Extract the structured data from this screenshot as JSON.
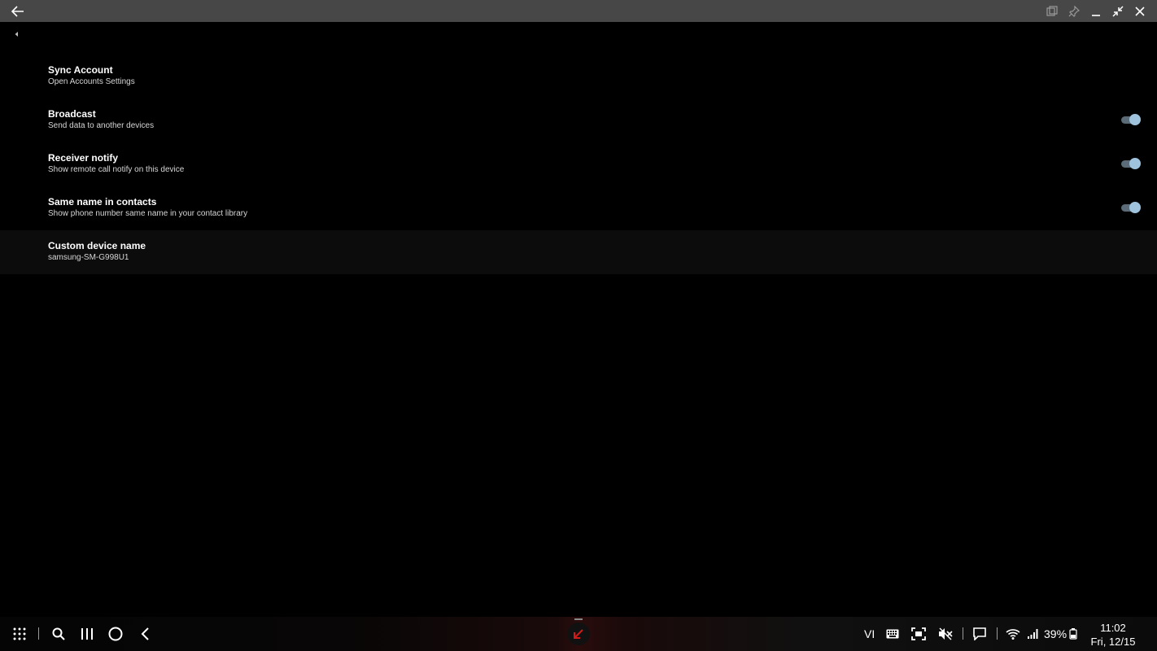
{
  "window": {
    "back_icon": "back-arrow-icon",
    "controls": [
      "popup-view-icon",
      "pin-icon",
      "minimize-icon",
      "restore-icon",
      "close-icon"
    ]
  },
  "settings": [
    {
      "title": "Sync Account",
      "subtitle": "Open Accounts Settings",
      "toggle": null
    },
    {
      "title": "Broadcast",
      "subtitle": "Send data to another devices",
      "toggle": true
    },
    {
      "title": "Receiver notify",
      "subtitle": "Show remote call notify on this device",
      "toggle": true
    },
    {
      "title": "Same name in contacts",
      "subtitle": "Show phone number same name in your contact library",
      "toggle": true
    },
    {
      "title": "Custom device name",
      "subtitle": "samsung-SM-G998U1",
      "toggle": null
    }
  ],
  "taskbar": {
    "left_icons": [
      "apps-grid-icon",
      "search-icon",
      "recents-icon",
      "home-icon",
      "back-icon"
    ],
    "language": "VI",
    "battery": "39%",
    "time": "11:02",
    "date": "Fri, 12/15"
  },
  "colors": {
    "titlebar": "#474747",
    "background": "#000000",
    "toggle_knob": "#9fc3dc",
    "toggle_track": "#5b6b77",
    "accent_red": "#d11a1a"
  }
}
